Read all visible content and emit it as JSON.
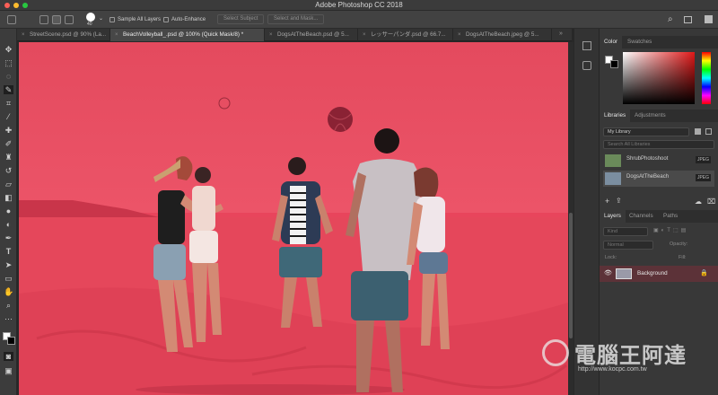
{
  "window": {
    "title": "Adobe Photoshop CC 2018"
  },
  "options_bar": {
    "brush_size": "40",
    "sample_all_layers": "Sample All Layers",
    "auto_enhance": "Auto-Enhance",
    "select_subject": "Select Subject",
    "select_and_mask": "Select and Mask..."
  },
  "tabs": [
    {
      "label": "StreetScene.psd @ 90% (La..."
    },
    {
      "label": "BeachVolleyball_.psd @ 100% (Quick Mask/8) *"
    },
    {
      "label": "DogsAtTheBeach.psd @ 5..."
    },
    {
      "label": "レッサーパンダ.psd @ 66.7..."
    },
    {
      "label": "DogsAtTheBeach.jpeg @ 5..."
    }
  ],
  "color_panel": {
    "tabs": [
      "Color",
      "Swatches"
    ]
  },
  "libraries_panel": {
    "tabs": [
      "Libraries",
      "Adjustments"
    ],
    "library_name": "My Library",
    "search_placeholder": "Search All Libraries",
    "items": [
      {
        "name": "ShrubPhotoshoot",
        "badge": "JPEG"
      },
      {
        "name": "DogsAtTheBeach",
        "badge": "JPEG"
      }
    ]
  },
  "layers_panel": {
    "tabs": [
      "Layers",
      "Channels",
      "Paths"
    ],
    "kind_label": "Kind",
    "blend_mode": "Normal",
    "opacity_label": "Opacity:",
    "lock_label": "Lock:",
    "fill_label": "Fill:",
    "layers": [
      {
        "name": "Background"
      }
    ]
  },
  "watermark": {
    "text": "電腦王阿達",
    "url": "http://www.kocpc.com.tw"
  },
  "colors": {
    "quick_mask": "#e8455c",
    "panel_bg": "#383838",
    "selected_layer": "#5c3238"
  },
  "icons": {
    "toolbar": [
      "move-icon",
      "marquee-icon",
      "lasso-icon",
      "quick-selection-icon",
      "crop-icon",
      "eyedropper-icon",
      "healing-icon",
      "brush-icon",
      "clone-stamp-icon",
      "history-brush-icon",
      "eraser-icon",
      "gradient-icon",
      "blur-icon",
      "dodge-icon",
      "pen-icon",
      "type-icon",
      "path-select-icon",
      "rectangle-icon",
      "hand-icon",
      "zoom-icon",
      "more-icon"
    ]
  }
}
